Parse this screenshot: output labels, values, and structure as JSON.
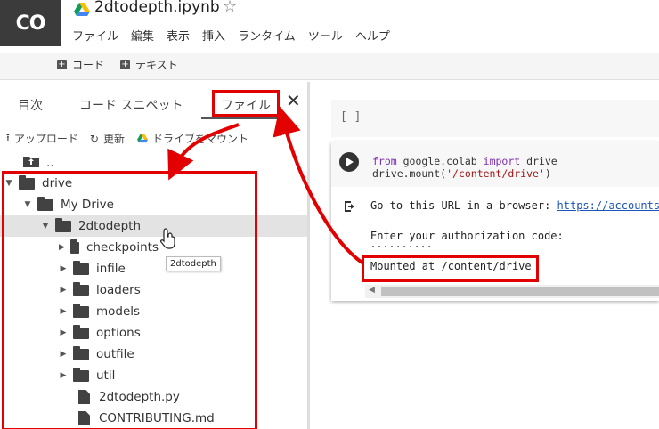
{
  "app": {
    "logo_text": "CO",
    "notebook_title": "2dtodepth.ipynb",
    "star": "☆"
  },
  "menu": [
    "ファイル",
    "編集",
    "表示",
    "挿入",
    "ランタイム",
    "ツール",
    "ヘルプ"
  ],
  "toolbar": {
    "code_label": "コード",
    "text_label": "テキスト"
  },
  "sidebar": {
    "tabs": [
      "目次",
      "コード スニペット",
      "ファイル"
    ],
    "active_tab": "ファイル",
    "close": "✕",
    "actions": {
      "upload": "アップロード",
      "refresh": "更新",
      "mount": "ドライブをマウント"
    },
    "tree": [
      {
        "label": "..",
        "type": "up"
      },
      {
        "label": "drive",
        "type": "folder",
        "expanded": true
      },
      {
        "label": "My Drive",
        "type": "folder",
        "expanded": true
      },
      {
        "label": "2dtodepth",
        "type": "folder",
        "expanded": true,
        "selected": true
      },
      {
        "label": "checkpoints",
        "type": "folder"
      },
      {
        "label": "infile",
        "type": "folder"
      },
      {
        "label": "loaders",
        "type": "folder"
      },
      {
        "label": "models",
        "type": "folder"
      },
      {
        "label": "options",
        "type": "folder"
      },
      {
        "label": "outfile",
        "type": "folder"
      },
      {
        "label": "util",
        "type": "folder"
      },
      {
        "label": "2dtodepth.py",
        "type": "file"
      },
      {
        "label": "CONTRIBUTING.md",
        "type": "file"
      }
    ],
    "tooltip": "2dtodepth"
  },
  "cells": {
    "empty_cell_brackets": "[ ]",
    "code_line1": {
      "k1": "from",
      "mod": " google.colab ",
      "k2": "import",
      "rest": " drive"
    },
    "code_line2": {
      "pre": "drive.mount(",
      "str": "'/content/drive'",
      "post": ")"
    },
    "output": {
      "line1_text": "Go to this URL in a browser: ",
      "line1_link": "https://accounts.",
      "line2": "Enter your authorization code:",
      "line3": "··········",
      "line4": "Mounted at /content/drive"
    }
  },
  "colors": {
    "annotation": "#e30000",
    "header_logo_bg": "#3b3b3b",
    "link": "#1a55b8"
  }
}
